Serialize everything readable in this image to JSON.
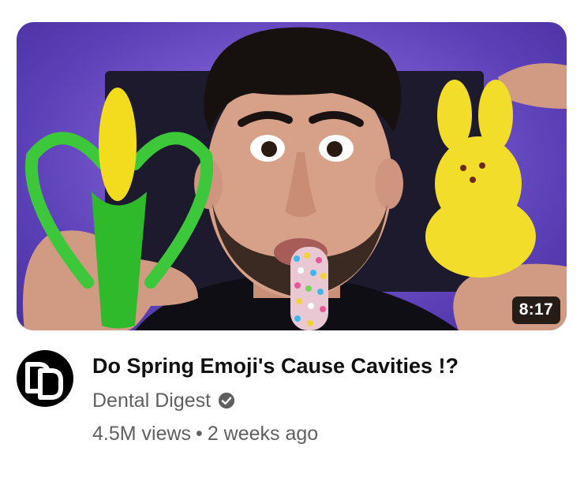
{
  "video": {
    "duration": "8:17",
    "title": "Do Spring Emoji's Cause Cavities !?",
    "channel": "Dental Digest",
    "views": "4.5M views",
    "separator": "•",
    "age": "2 weeks ago",
    "verified": true
  },
  "icons": {
    "avatar": "channel-logo-dd",
    "verified": "verified-check-icon"
  },
  "colors": {
    "title": "#0f0f0f",
    "secondary": "#606060",
    "duration_bg": "#000000",
    "thumbnail_bg": "#7a5cd0"
  }
}
